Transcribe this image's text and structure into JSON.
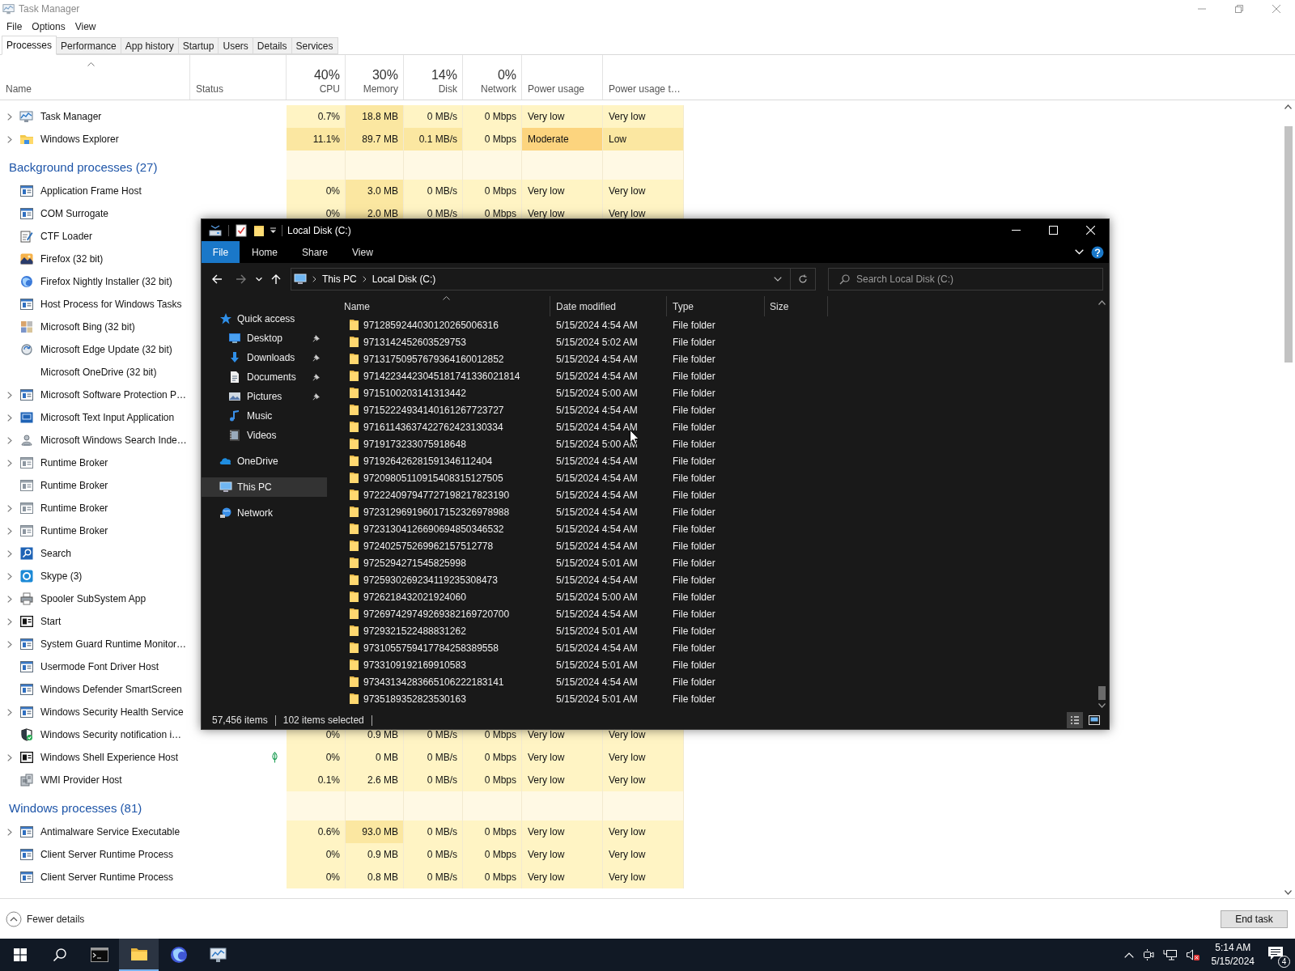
{
  "task_manager": {
    "title": "Task Manager",
    "menu": [
      "File",
      "Options",
      "View"
    ],
    "tabs": [
      {
        "label": "Processes",
        "selected": true
      },
      {
        "label": "Performance",
        "selected": false
      },
      {
        "label": "App history",
        "selected": false
      },
      {
        "label": "Startup",
        "selected": false
      },
      {
        "label": "Users",
        "selected": false
      },
      {
        "label": "Details",
        "selected": false
      },
      {
        "label": "Services",
        "selected": false
      }
    ],
    "columns": [
      {
        "label": "Name"
      },
      {
        "label": "Status"
      },
      {
        "percent": "40%",
        "label": "CPU"
      },
      {
        "percent": "30%",
        "label": "Memory"
      },
      {
        "percent": "14%",
        "label": "Disk"
      },
      {
        "percent": "0%",
        "label": "Network"
      },
      {
        "label": "Power usage"
      },
      {
        "label": "Power usage t…"
      }
    ],
    "rows": [
      {
        "kind": "process",
        "name": "Task Manager",
        "expandable": true,
        "eco": false,
        "cells": [
          {
            "text": "0.7%",
            "color": "#fff4c4"
          },
          {
            "text": "18.8 MB",
            "color": "#fbe7a1"
          },
          {
            "text": "0 MB/s",
            "color": "#fff4c4"
          },
          {
            "text": "0 Mbps",
            "color": "#fff4c4"
          },
          {
            "text": "Very low",
            "color": "#fff4c4"
          },
          {
            "text": "Very low",
            "color": "#fff4c4"
          }
        ]
      },
      {
        "kind": "process",
        "name": "Windows Explorer",
        "expandable": true,
        "eco": false,
        "cells": [
          {
            "text": "11.1%",
            "color": "#fbe7a1"
          },
          {
            "text": "89.7 MB",
            "color": "#fbe7a1"
          },
          {
            "text": "0.1 MB/s",
            "color": "#fbe7a1"
          },
          {
            "text": "0 Mbps",
            "color": "#fff4c4"
          },
          {
            "text": "Moderate",
            "color": "#fcd47e"
          },
          {
            "text": "Low",
            "color": "#fbe7a1"
          }
        ]
      },
      {
        "kind": "group",
        "label": "Background processes (27)"
      },
      {
        "kind": "process",
        "name": "Application Frame Host",
        "expandable": false,
        "eco": false,
        "cells": [
          {
            "text": "0%",
            "color": "#fff4c4"
          },
          {
            "text": "3.0 MB",
            "color": "#fbe7a1"
          },
          {
            "text": "0 MB/s",
            "color": "#fff4c4"
          },
          {
            "text": "0 Mbps",
            "color": "#fff4c4"
          },
          {
            "text": "Very low",
            "color": "#fff4c4"
          },
          {
            "text": "Very low",
            "color": "#fff4c4"
          }
        ]
      },
      {
        "kind": "process",
        "name": "COM Surrogate",
        "expandable": false,
        "eco": false,
        "cells": [
          {
            "text": "0%",
            "color": "#fff4c4"
          },
          {
            "text": "2.0 MB",
            "color": "#fbe7a1"
          },
          {
            "text": "0 MB/s",
            "color": "#fff4c4"
          },
          {
            "text": "0 Mbps",
            "color": "#fff4c4"
          },
          {
            "text": "Very low",
            "color": "#fff4c4"
          },
          {
            "text": "Very low",
            "color": "#fff4c4"
          }
        ]
      },
      {
        "kind": "process",
        "name": "CTF Loader",
        "expandable": false,
        "eco": false
      },
      {
        "kind": "process",
        "name": "Firefox (32 bit)",
        "expandable": false,
        "eco": false
      },
      {
        "kind": "process",
        "name": "Firefox Nightly Installer (32 bit)",
        "expandable": false,
        "eco": false
      },
      {
        "kind": "process",
        "name": "Host Process for Windows Tasks",
        "expandable": false,
        "eco": false
      },
      {
        "kind": "process",
        "name": "Microsoft Bing (32 bit)",
        "expandable": false,
        "eco": false
      },
      {
        "kind": "process",
        "name": "Microsoft Edge Update (32 bit)",
        "expandable": false,
        "eco": false
      },
      {
        "kind": "process",
        "name": "Microsoft OneDrive (32 bit)",
        "expandable": false,
        "eco": false
      },
      {
        "kind": "process",
        "name": "Microsoft Software Protection P…",
        "expandable": true,
        "eco": false
      },
      {
        "kind": "process",
        "name": "Microsoft Text Input Application",
        "expandable": true,
        "eco": false
      },
      {
        "kind": "process",
        "name": "Microsoft Windows Search Inde…",
        "expandable": true,
        "eco": false
      },
      {
        "kind": "process",
        "name": "Runtime Broker",
        "expandable": true,
        "eco": false
      },
      {
        "kind": "process",
        "name": "Runtime Broker",
        "expandable": false,
        "eco": false
      },
      {
        "kind": "process",
        "name": "Runtime Broker",
        "expandable": true,
        "eco": false
      },
      {
        "kind": "process",
        "name": "Runtime Broker",
        "expandable": true,
        "eco": false
      },
      {
        "kind": "process",
        "name": "Search",
        "expandable": true,
        "eco": false
      },
      {
        "kind": "process",
        "name": "Skype (3)",
        "expandable": true,
        "eco": false
      },
      {
        "kind": "process",
        "name": "Spooler SubSystem App",
        "expandable": true,
        "eco": false
      },
      {
        "kind": "process",
        "name": "Start",
        "expandable": true,
        "eco": false
      },
      {
        "kind": "process",
        "name": "System Guard Runtime Monitor…",
        "expandable": true,
        "eco": false
      },
      {
        "kind": "process",
        "name": "Usermode Font Driver Host",
        "expandable": false,
        "eco": false
      },
      {
        "kind": "process",
        "name": "Windows Defender SmartScreen",
        "expandable": false,
        "eco": false
      },
      {
        "kind": "process",
        "name": "Windows Security Health Service",
        "expandable": true,
        "eco": false
      },
      {
        "kind": "process",
        "name": "Windows Security notification i…",
        "expandable": false,
        "eco": false,
        "cells": [
          {
            "text": "0%",
            "color": "#fff4c4"
          },
          {
            "text": "0.9 MB",
            "color": "#fff4c4"
          },
          {
            "text": "0 MB/s",
            "color": "#fff4c4"
          },
          {
            "text": "0 Mbps",
            "color": "#fff4c4"
          },
          {
            "text": "Very low",
            "color": "#fff4c4"
          },
          {
            "text": "Very low",
            "color": "#fff4c4"
          }
        ]
      },
      {
        "kind": "process",
        "name": "Windows Shell Experience Host",
        "expandable": true,
        "eco": true,
        "cells": [
          {
            "text": "0%",
            "color": "#fff4c4"
          },
          {
            "text": "0 MB",
            "color": "#fff4c4"
          },
          {
            "text": "0 MB/s",
            "color": "#fff4c4"
          },
          {
            "text": "0 Mbps",
            "color": "#fff4c4"
          },
          {
            "text": "Very low",
            "color": "#fff4c4"
          },
          {
            "text": "Very low",
            "color": "#fff4c4"
          }
        ]
      },
      {
        "kind": "process",
        "name": "WMI Provider Host",
        "expandable": false,
        "eco": false,
        "cells": [
          {
            "text": "0.1%",
            "color": "#fff4c4"
          },
          {
            "text": "2.6 MB",
            "color": "#fff4c4"
          },
          {
            "text": "0 MB/s",
            "color": "#fff4c4"
          },
          {
            "text": "0 Mbps",
            "color": "#fff4c4"
          },
          {
            "text": "Very low",
            "color": "#fff4c4"
          },
          {
            "text": "Very low",
            "color": "#fff4c4"
          }
        ]
      },
      {
        "kind": "group",
        "label": "Windows processes (81)"
      },
      {
        "kind": "process",
        "name": "Antimalware Service Executable",
        "expandable": true,
        "eco": false,
        "cells": [
          {
            "text": "0.6%",
            "color": "#fff4c4"
          },
          {
            "text": "93.0 MB",
            "color": "#fbe7a1"
          },
          {
            "text": "0 MB/s",
            "color": "#fff4c4"
          },
          {
            "text": "0 Mbps",
            "color": "#fff4c4"
          },
          {
            "text": "Very low",
            "color": "#fff4c4"
          },
          {
            "text": "Very low",
            "color": "#fff4c4"
          }
        ]
      },
      {
        "kind": "process",
        "name": "Client Server Runtime Process",
        "expandable": false,
        "eco": false,
        "cells": [
          {
            "text": "0%",
            "color": "#fff4c4"
          },
          {
            "text": "0.9 MB",
            "color": "#fff4c4"
          },
          {
            "text": "0 MB/s",
            "color": "#fff4c4"
          },
          {
            "text": "0 Mbps",
            "color": "#fff4c4"
          },
          {
            "text": "Very low",
            "color": "#fff4c4"
          },
          {
            "text": "Very low",
            "color": "#fff4c4"
          }
        ]
      },
      {
        "kind": "process",
        "name": "Client Server Runtime Process",
        "expandable": false,
        "eco": false,
        "cells": [
          {
            "text": "0%",
            "color": "#fff4c4"
          },
          {
            "text": "0.8 MB",
            "color": "#fff4c4"
          },
          {
            "text": "0 MB/s",
            "color": "#fff4c4"
          },
          {
            "text": "0 Mbps",
            "color": "#fff4c4"
          },
          {
            "text": "Very low",
            "color": "#fff4c4"
          },
          {
            "text": "Very low",
            "color": "#fff4c4"
          }
        ]
      }
    ],
    "footer": {
      "fewer_details": "Fewer details",
      "end_task": "End task"
    }
  },
  "explorer": {
    "title": "Local Disk (C:)",
    "ribbon_tabs": [
      {
        "label": "File",
        "selected": true
      },
      {
        "label": "Home",
        "selected": false
      },
      {
        "label": "Share",
        "selected": false
      },
      {
        "label": "View",
        "selected": false
      }
    ],
    "path": [
      "This PC",
      "Local Disk (C:)"
    ],
    "search": {
      "placeholder": "Search Local Disk (C:)"
    },
    "nav": [
      {
        "label": "Quick access",
        "selected": false,
        "children": [
          {
            "label": "Desktop",
            "pinned": true,
            "selected": false
          },
          {
            "label": "Downloads",
            "pinned": true,
            "selected": false
          },
          {
            "label": "Documents",
            "pinned": true,
            "selected": false
          },
          {
            "label": "Pictures",
            "pinned": true,
            "selected": false
          },
          {
            "label": "Music",
            "pinned": false,
            "selected": false
          },
          {
            "label": "Videos",
            "pinned": false,
            "selected": false
          }
        ]
      },
      {
        "label": "OneDrive",
        "selected": false
      },
      {
        "label": "This PC",
        "selected": true
      },
      {
        "label": "Network",
        "selected": false
      }
    ],
    "columns": [
      "Name",
      "Date modified",
      "Type",
      "Size"
    ],
    "files": [
      {
        "name": "9712859244030120265006316",
        "date": "5/15/2024 4:54 AM",
        "type": "File folder"
      },
      {
        "name": "9713142452603529753",
        "date": "5/15/2024 5:02 AM",
        "type": "File folder"
      },
      {
        "name": "97131750957679364160012852",
        "date": "5/15/2024 4:54 AM",
        "type": "File folder"
      },
      {
        "name": "97142234423045181741336021814",
        "date": "5/15/2024 4:54 AM",
        "type": "File folder"
      },
      {
        "name": "9715100203141313442",
        "date": "5/15/2024 5:00 AM",
        "type": "File folder"
      },
      {
        "name": "97152224934140161267723727",
        "date": "5/15/2024 4:54 AM",
        "type": "File folder"
      },
      {
        "name": "97161143637422762423130334",
        "date": "5/15/2024 4:54 AM",
        "type": "File folder"
      },
      {
        "name": "9719173233075918648",
        "date": "5/15/2024 5:00 AM",
        "type": "File folder"
      },
      {
        "name": "971926426281591346112404",
        "date": "5/15/2024 4:54 AM",
        "type": "File folder"
      },
      {
        "name": "97209805110915408315127505",
        "date": "5/15/2024 4:54 AM",
        "type": "File folder"
      },
      {
        "name": "972224097947727198217823190",
        "date": "5/15/2024 4:54 AM",
        "type": "File folder"
      },
      {
        "name": "972312969196017152326978988",
        "date": "5/15/2024 4:54 AM",
        "type": "File folder"
      },
      {
        "name": "97231304126690694850346532",
        "date": "5/15/2024 4:54 AM",
        "type": "File folder"
      },
      {
        "name": "972402575269962157512778",
        "date": "5/15/2024 4:54 AM",
        "type": "File folder"
      },
      {
        "name": "9725294271545825998",
        "date": "5/15/2024 5:01 AM",
        "type": "File folder"
      },
      {
        "name": "9725930269234119235308473",
        "date": "5/15/2024 4:54 AM",
        "type": "File folder"
      },
      {
        "name": "9726218432021924060",
        "date": "5/15/2024 5:00 AM",
        "type": "File folder"
      },
      {
        "name": "972697429749269382169720700",
        "date": "5/15/2024 4:54 AM",
        "type": "File folder"
      },
      {
        "name": "9729321522488831262",
        "date": "5/15/2024 5:01 AM",
        "type": "File folder"
      },
      {
        "name": "9731055759417784258389558",
        "date": "5/15/2024 4:54 AM",
        "type": "File folder"
      },
      {
        "name": "9733109192169910583",
        "date": "5/15/2024 5:01 AM",
        "type": "File folder"
      },
      {
        "name": "97343134283665106222183141",
        "date": "5/15/2024 4:54 AM",
        "type": "File folder"
      },
      {
        "name": "9735189352823530163",
        "date": "5/15/2024 5:01 AM",
        "type": "File folder"
      }
    ],
    "status": {
      "items": "57,456 items",
      "selection": "102 items selected"
    }
  },
  "taskbar": {
    "apps": [
      {
        "selected": false
      },
      {
        "selected": true
      },
      {
        "selected": false
      },
      {
        "selected": false
      }
    ],
    "time": "5:14 AM",
    "date": "5/15/2024",
    "notifications": "4"
  }
}
